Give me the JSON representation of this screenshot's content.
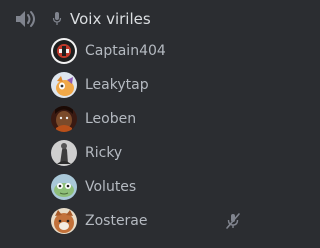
{
  "channel": {
    "name": "Voix viriles",
    "icon": "speaker-icon",
    "mic_icon": "microphone-icon"
  },
  "users": [
    {
      "name": "Captain404",
      "avatar": "avatar-captain404",
      "muted": false
    },
    {
      "name": "Leakytap",
      "avatar": "avatar-leakytap",
      "muted": false
    },
    {
      "name": "Leoben",
      "avatar": "avatar-leoben",
      "muted": false
    },
    {
      "name": "Ricky",
      "avatar": "avatar-ricky",
      "muted": false
    },
    {
      "name": "Volutes",
      "avatar": "avatar-volutes",
      "muted": false
    },
    {
      "name": "Zosterae",
      "avatar": "avatar-zosterae",
      "muted": true
    }
  ],
  "colors": {
    "background": "#2b2d31",
    "channel_text": "#dbdee1",
    "user_text": "#b5bac1",
    "icon": "#80848e"
  }
}
